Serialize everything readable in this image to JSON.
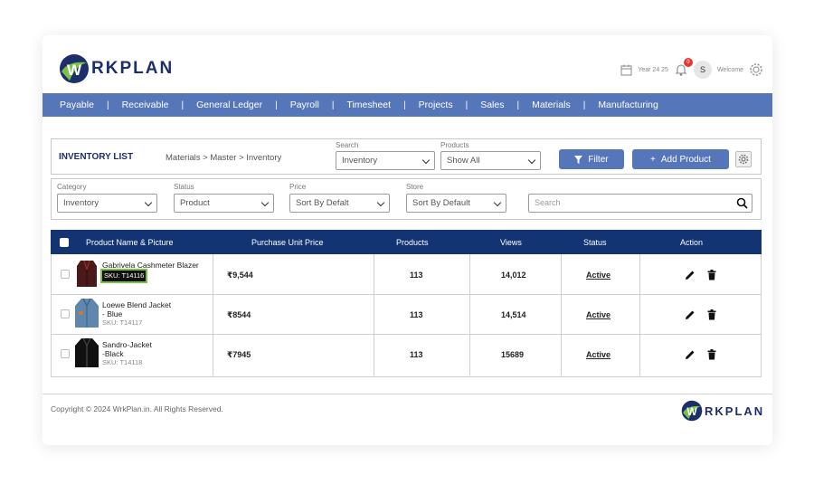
{
  "brand": {
    "logo_w": "W",
    "logo_text": "RKPLAN"
  },
  "header": {
    "year": "Year 24 25",
    "notifications": "0",
    "avatar_initial": "S",
    "welcome": "Welcome"
  },
  "nav": [
    "Payable",
    "Receivable",
    "General Ledger",
    "Payroll",
    "Timesheet",
    "Projects",
    "Sales",
    "Materials",
    "Manufacturing"
  ],
  "toolbar": {
    "title": "INVENTORY LIST",
    "breadcrumb": "Materials > Master > Inventory",
    "search_label": "Search",
    "search_value": "Inventory",
    "products_label": "Products",
    "products_value": "Show All",
    "filter_label": "Filter",
    "add_label": "Add Product"
  },
  "filters": {
    "category_label": "Category",
    "category_value": "Inventory",
    "status_label": "Status",
    "status_value": "Product",
    "price_label": "Price",
    "price_value": "Sort By Defalt",
    "store_label": "Store",
    "store_value": "Sort By Default",
    "search_placeholder": "Search"
  },
  "table": {
    "headers": [
      "Product Name & Picture",
      "Purchase Unit Price",
      "Products",
      "Views",
      "Status",
      "Action"
    ],
    "rows": [
      {
        "name1": "Gabrivela Cashmeter Blazer",
        "name2": "",
        "sku": "SKU: T14116",
        "price": "₹9,544",
        "products": "113",
        "views": "14,012",
        "status": "Active"
      },
      {
        "name1": "Loewe Blend Jacket",
        "name2": "- Blue",
        "sku": "SKU: T14117",
        "price": "₹8544",
        "products": "113",
        "views": "14,514",
        "status": "Active"
      },
      {
        "name1": "Sandro-Jacket",
        "name2": "-Black",
        "sku": "SKU: T14118",
        "price": "₹7945",
        "products": "113",
        "views": "15689",
        "status": "Active"
      }
    ]
  },
  "footer": {
    "copyright": "Copyright © 2024 WrkPlan.in. All Rights Reserved."
  },
  "colors": {
    "nav": "#5676ba",
    "table_header": "#123473",
    "brand_green": "#7cc242",
    "brand_navy": "#1c2f6b"
  }
}
